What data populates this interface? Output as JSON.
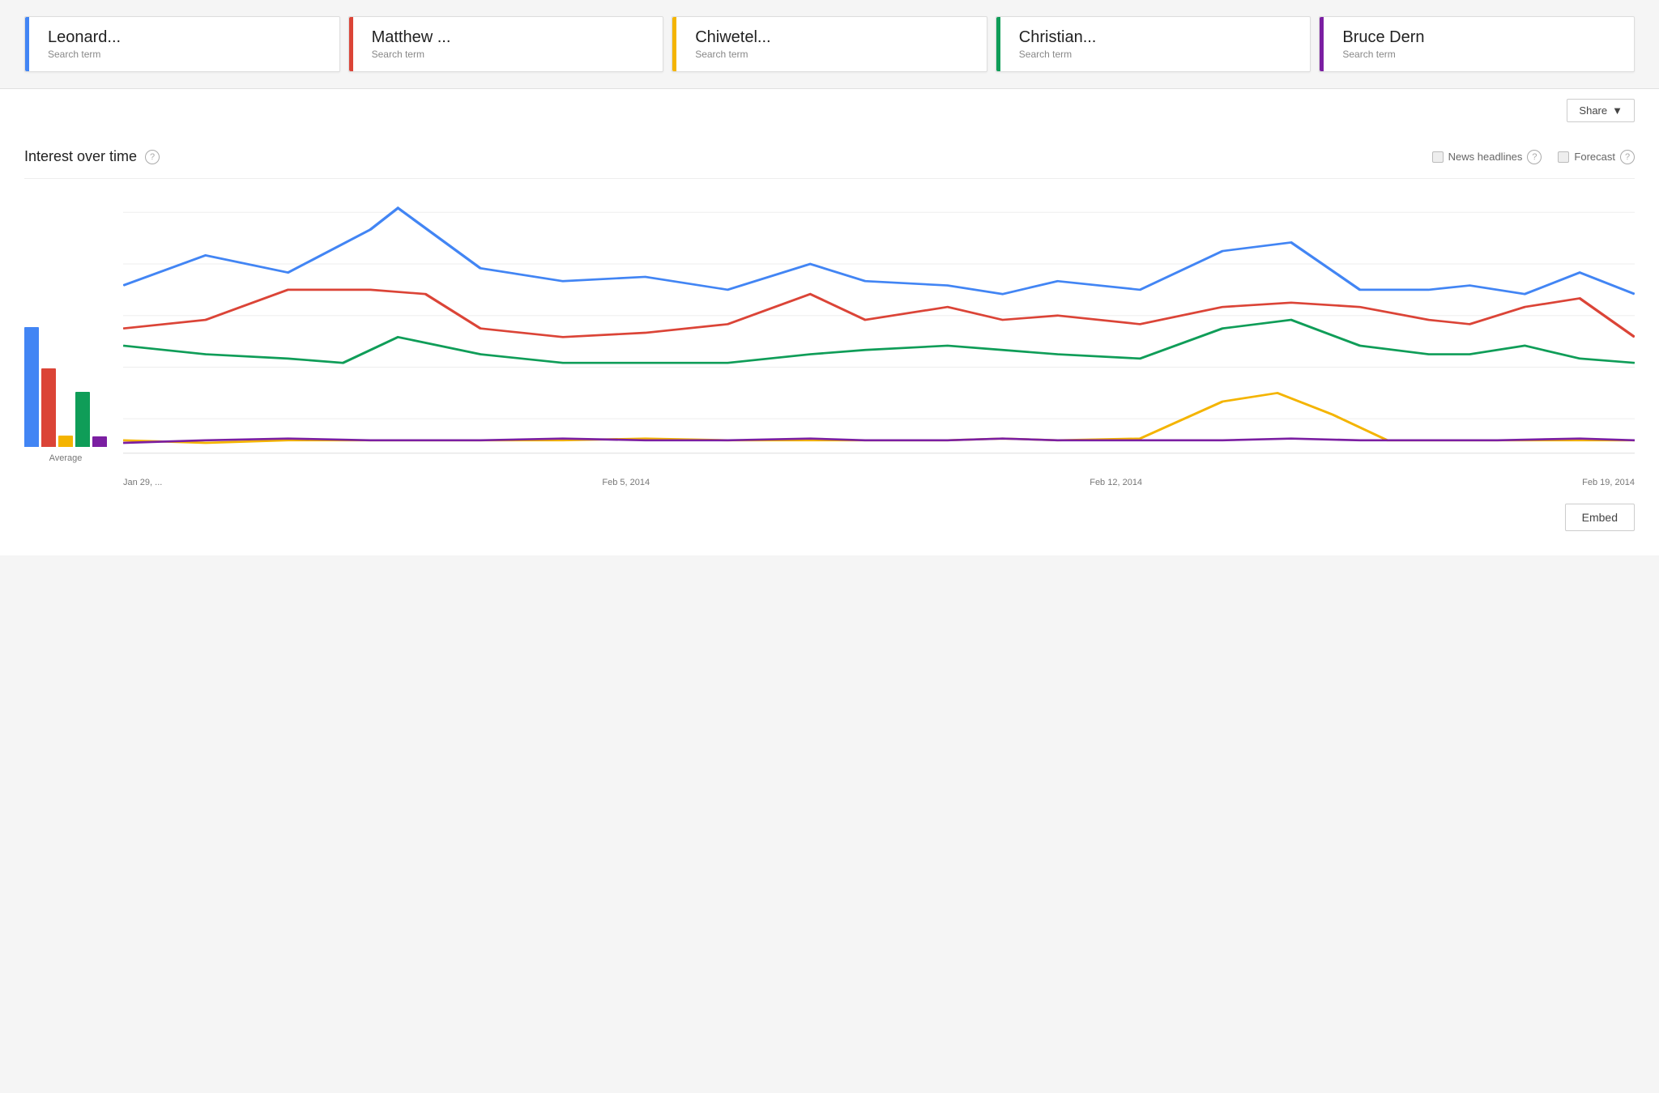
{
  "searchTerms": [
    {
      "id": "leonard",
      "name": "Leonard...",
      "type": "Search term",
      "color": "#4285F4"
    },
    {
      "id": "matthew",
      "name": "Matthew ...",
      "type": "Search term",
      "color": "#DB4437"
    },
    {
      "id": "chiwetel",
      "name": "Chiwetel...",
      "type": "Search term",
      "color": "#F4B400"
    },
    {
      "id": "christian",
      "name": "Christian...",
      "type": "Search term",
      "color": "#0F9D58"
    },
    {
      "id": "brucedern",
      "name": "Bruce Dern",
      "type": "Search term",
      "color": "#7B1FA2"
    }
  ],
  "shareButton": {
    "label": "Share"
  },
  "section": {
    "title": "Interest over time",
    "helpLabel": "?",
    "newsHeadlines": {
      "label": "News headlines",
      "helpLabel": "?"
    },
    "forecast": {
      "label": "Forecast",
      "helpLabel": "?"
    }
  },
  "avgBars": [
    {
      "color": "#4285F4",
      "heightPct": 82
    },
    {
      "color": "#DB4437",
      "heightPct": 54
    },
    {
      "color": "#F4B400",
      "heightPct": 8
    },
    {
      "color": "#0F9D58",
      "heightPct": 38
    },
    {
      "color": "#7B1FA2",
      "heightPct": 7
    }
  ],
  "avgLabel": "Average",
  "xAxisLabels": [
    "Jan 29, ...",
    "Feb 5, 2014",
    "Feb 12, 2014",
    "Feb 19, 2014"
  ],
  "embedButton": {
    "label": "Embed"
  }
}
